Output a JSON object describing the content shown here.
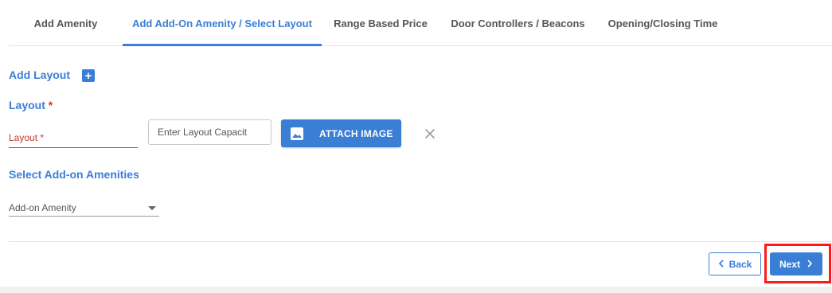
{
  "tabs": [
    {
      "label": "Add Amenity"
    },
    {
      "label": "Add Add-On Amenity / Select Layout",
      "active": true
    },
    {
      "label": "Range Based Price"
    },
    {
      "label": "Door Controllers / Beacons"
    },
    {
      "label": "Opening/Closing Time"
    }
  ],
  "add_layout": {
    "title": "Add Layout",
    "add_icon": "plus-square-icon"
  },
  "layout_section": {
    "title": "Layout",
    "required_mark": "*"
  },
  "layout_field": {
    "label": "Layout *"
  },
  "capacity_input": {
    "placeholder": "Enter Layout Capacit",
    "value": ""
  },
  "attach_button": {
    "label": "ATTACH IMAGE",
    "icon": "image-icon"
  },
  "remove_icon": "close-icon",
  "addon_section": {
    "title": "Select Add-on Amenities"
  },
  "addon_select": {
    "label": "Add-on Amenity",
    "icon": "dropdown-caret-icon"
  },
  "footer": {
    "back_label": "Back",
    "next_label": "Next"
  },
  "colors": {
    "accent": "#3a7ed6",
    "error": "#c0392b",
    "highlight": "#ff1a1a"
  }
}
